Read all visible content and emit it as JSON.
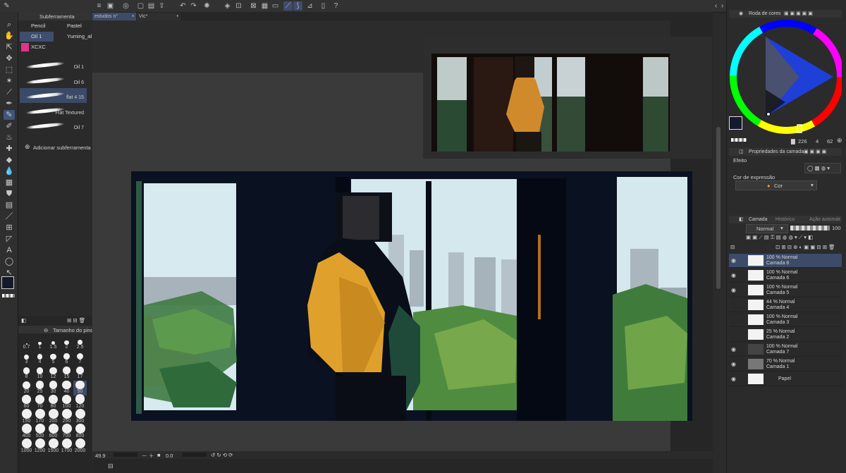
{
  "document_tabs": [
    "estudos n°",
    "Vic*"
  ],
  "subtool": {
    "panel_title": "Subferramenta",
    "tabs": [
      "Pencil",
      "Pastel",
      "Oil 1",
      "Yuming_ab",
      "XCXC"
    ],
    "brushes": [
      "Oil 1",
      "Oil 6",
      "flat 4 15",
      "Flat Textured",
      "Oil 7"
    ],
    "add_label": "Adicionar subferramenta"
  },
  "brush_size": {
    "panel_title": "Tamanho do pincel",
    "sizes": [
      "0.7",
      "1",
      "1.5",
      "2",
      "2.5",
      "3",
      "4",
      "5",
      "6",
      "7",
      "8",
      "10",
      "12",
      "15",
      "17",
      "20",
      "25",
      "30",
      "40",
      "50",
      "60",
      "70",
      "80",
      "100",
      "120",
      "150",
      "170",
      "200",
      "250",
      "300",
      "400",
      "500",
      "600",
      "700",
      "800",
      "1000",
      "1200",
      "1500",
      "1700",
      "2000"
    ],
    "selected": "50"
  },
  "status": {
    "zoom": "49.9",
    "angle": "0.0"
  },
  "color_wheel": {
    "panel_title": "Roda de cores",
    "h": "226",
    "s": "4",
    "v": "62",
    "main_color": "#141a2c"
  },
  "layer_props": {
    "panel_title": "Propriedades da camada",
    "effect_label": "Efeito",
    "expression_label": "Cor de expressão",
    "expression_value": "Cor"
  },
  "layers_panel": {
    "tabs": [
      "Camada",
      "Histórico",
      "Ação automática"
    ],
    "blend_mode": "Normal",
    "opacity": "100",
    "layers": [
      {
        "opacity": "100 % Normal",
        "name": "Camada 8",
        "visible": true,
        "selected": true
      },
      {
        "opacity": "100 % Normal",
        "name": "Camada 6",
        "visible": true,
        "selected": false
      },
      {
        "opacity": "100 % Normal",
        "name": "Camada 5",
        "visible": true,
        "selected": false
      },
      {
        "opacity": "44 % Normal",
        "name": "Camada 4",
        "visible": false,
        "selected": false
      },
      {
        "opacity": "100 % Normal",
        "name": "Camada 3",
        "visible": false,
        "selected": false
      },
      {
        "opacity": "25 % Normal",
        "name": "Camada 2",
        "visible": false,
        "selected": false
      },
      {
        "opacity": "100 % Normal",
        "name": "Camada 7",
        "visible": true,
        "selected": false
      },
      {
        "opacity": "70 % Normal",
        "name": "Camada 1",
        "visible": true,
        "selected": false
      },
      {
        "opacity": "",
        "name": "Papel",
        "visible": true,
        "selected": false
      }
    ]
  }
}
